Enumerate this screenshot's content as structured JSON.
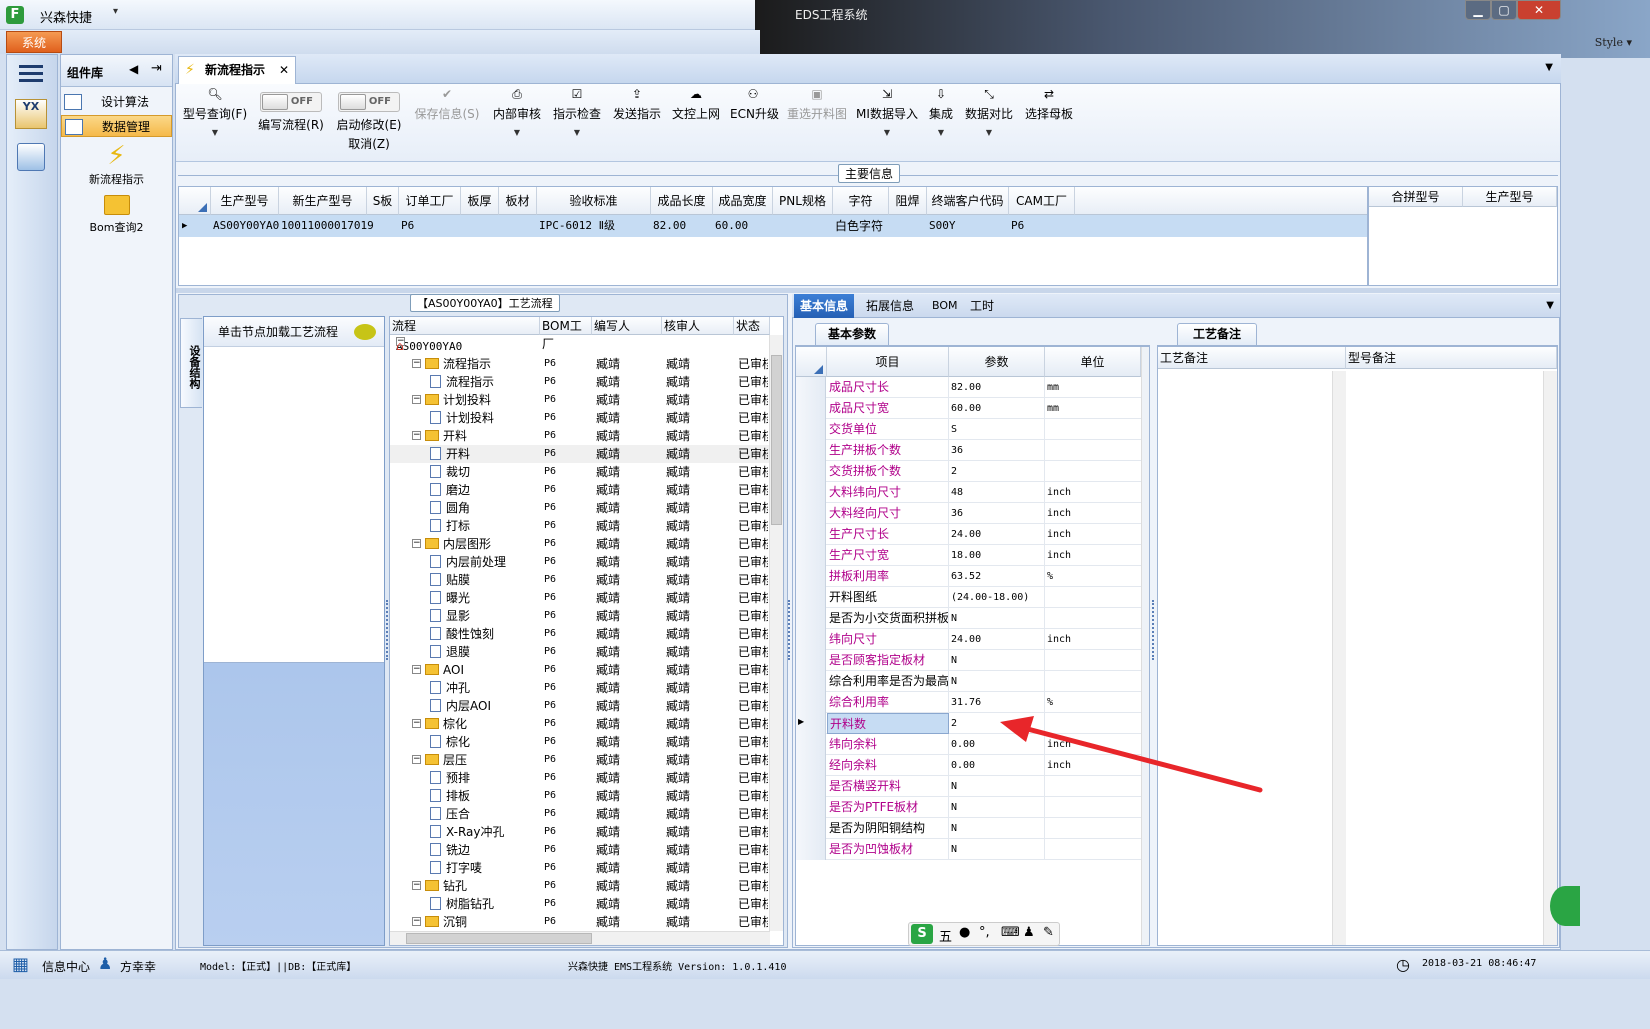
{
  "window": {
    "app_title": "兴森快捷",
    "center_title": "EDS工程系统",
    "style_label": "Style",
    "menu_tab": "系统"
  },
  "left_nav": {
    "header": "组件库",
    "items": [
      {
        "label": "设计算法",
        "selected": false
      },
      {
        "label": "数据管理",
        "selected": true
      }
    ],
    "shortcuts": [
      {
        "label": "新流程指示",
        "icon": "lightning-icon"
      },
      {
        "label": "Bom查询2",
        "icon": "folder-icon"
      }
    ]
  },
  "doc_tab": {
    "label": "新流程指示"
  },
  "ribbon": {
    "buttons": [
      {
        "label": "型号查询(F)",
        "icon": "search-icon",
        "enabled": true,
        "dropdown": true
      },
      {
        "label": "编写流程(R)",
        "toggle": "OFF"
      },
      {
        "label": "启动修改(E)",
        "label2": "取消(Z)",
        "toggle": "OFF"
      },
      {
        "label": "保存信息(S)",
        "icon": "check-icon",
        "enabled": false
      },
      {
        "label": "内部审核",
        "icon": "print-icon",
        "enabled": true,
        "dropdown": true
      },
      {
        "label": "指示检查",
        "icon": "checkbox-icon",
        "enabled": true,
        "dropdown": true
      },
      {
        "label": "发送指示",
        "icon": "upload-icon",
        "enabled": true
      },
      {
        "label": "文控上网",
        "icon": "cloud-upload-icon",
        "enabled": true
      },
      {
        "label": "ECN升级",
        "icon": "binoculars-icon",
        "enabled": true
      },
      {
        "label": "重选开料图",
        "icon": "image-icon",
        "enabled": false
      },
      {
        "label": "MI数据导入",
        "icon": "import-icon",
        "enabled": true,
        "dropdown": true
      },
      {
        "label": "集成",
        "icon": "download-icon",
        "enabled": true,
        "dropdown": true
      },
      {
        "label": "数据对比",
        "icon": "compress-icon",
        "enabled": true,
        "dropdown": true
      },
      {
        "label": "选择母板",
        "icon": "shuffle-icon",
        "enabled": true
      }
    ]
  },
  "main_info": {
    "section_label": "主要信息",
    "columns": [
      "生产型号",
      "新生产型号",
      "S板",
      "订单工厂",
      "板厚",
      "板材",
      "验收标准",
      "成品长度",
      "成品宽度",
      "PNL规格",
      "字符",
      "阻焊",
      "终端客户代码",
      "CAM工厂"
    ],
    "row": [
      "AS00Y00YA0",
      "10011000017019",
      "",
      "P6",
      "",
      "",
      "IPC-6012 Ⅱ级",
      "82.00",
      "60.00",
      "",
      "白色字符",
      "",
      "S00Y",
      "P6"
    ],
    "merge_columns": [
      "合拼型号",
      "生产型号"
    ]
  },
  "flow_panel": {
    "section_label": "【AS00Y00YA0】工艺流程",
    "side_tab": "设备结构",
    "load_hint": "单击节点加载工艺流程",
    "columns": [
      "流程",
      "BOM工厂",
      "编写人",
      "核审人",
      "状态"
    ],
    "root": "AS00Y00YA0",
    "rows": [
      {
        "name": "流程指示",
        "level": 1,
        "folder": true,
        "factory": "P6",
        "writer": "臧靖",
        "reviewer": "臧靖",
        "status": "已审核"
      },
      {
        "name": "流程指示",
        "level": 2,
        "folder": false,
        "factory": "P6",
        "writer": "臧靖",
        "reviewer": "臧靖",
        "status": "已审核"
      },
      {
        "name": "计划投料",
        "level": 1,
        "folder": true,
        "factory": "P6",
        "writer": "臧靖",
        "reviewer": "臧靖",
        "status": "已审核"
      },
      {
        "name": "计划投料",
        "level": 2,
        "folder": false,
        "factory": "P6",
        "writer": "臧靖",
        "reviewer": "臧靖",
        "status": "已审核"
      },
      {
        "name": "开料",
        "level": 1,
        "folder": true,
        "factory": "P6",
        "writer": "臧靖",
        "reviewer": "臧靖",
        "status": "已审核"
      },
      {
        "name": "开料",
        "level": 2,
        "folder": false,
        "factory": "P6",
        "writer": "臧靖",
        "reviewer": "臧靖",
        "status": "已审核",
        "selected": true
      },
      {
        "name": "裁切",
        "level": 2,
        "folder": false,
        "factory": "P6",
        "writer": "臧靖",
        "reviewer": "臧靖",
        "status": "已审核"
      },
      {
        "name": "磨边",
        "level": 2,
        "folder": false,
        "factory": "P6",
        "writer": "臧靖",
        "reviewer": "臧靖",
        "status": "已审核"
      },
      {
        "name": "圆角",
        "level": 2,
        "folder": false,
        "factory": "P6",
        "writer": "臧靖",
        "reviewer": "臧靖",
        "status": "已审核"
      },
      {
        "name": "打标",
        "level": 2,
        "folder": false,
        "factory": "P6",
        "writer": "臧靖",
        "reviewer": "臧靖",
        "status": "已审核"
      },
      {
        "name": "内层图形",
        "level": 1,
        "folder": true,
        "factory": "P6",
        "writer": "臧靖",
        "reviewer": "臧靖",
        "status": "已审核"
      },
      {
        "name": "内层前处理",
        "level": 2,
        "folder": false,
        "factory": "P6",
        "writer": "臧靖",
        "reviewer": "臧靖",
        "status": "已审核"
      },
      {
        "name": "贴膜",
        "level": 2,
        "folder": false,
        "factory": "P6",
        "writer": "臧靖",
        "reviewer": "臧靖",
        "status": "已审核"
      },
      {
        "name": "曝光",
        "level": 2,
        "folder": false,
        "factory": "P6",
        "writer": "臧靖",
        "reviewer": "臧靖",
        "status": "已审核"
      },
      {
        "name": "显影",
        "level": 2,
        "folder": false,
        "factory": "P6",
        "writer": "臧靖",
        "reviewer": "臧靖",
        "status": "已审核"
      },
      {
        "name": "酸性蚀刻",
        "level": 2,
        "folder": false,
        "factory": "P6",
        "writer": "臧靖",
        "reviewer": "臧靖",
        "status": "已审核"
      },
      {
        "name": "退膜",
        "level": 2,
        "folder": false,
        "factory": "P6",
        "writer": "臧靖",
        "reviewer": "臧靖",
        "status": "已审核"
      },
      {
        "name": "AOI",
        "level": 1,
        "folder": true,
        "factory": "P6",
        "writer": "臧靖",
        "reviewer": "臧靖",
        "status": "已审核"
      },
      {
        "name": "冲孔",
        "level": 2,
        "folder": false,
        "factory": "P6",
        "writer": "臧靖",
        "reviewer": "臧靖",
        "status": "已审核"
      },
      {
        "name": "内层AOI",
        "level": 2,
        "folder": false,
        "factory": "P6",
        "writer": "臧靖",
        "reviewer": "臧靖",
        "status": "已审核"
      },
      {
        "name": "棕化",
        "level": 1,
        "folder": true,
        "factory": "P6",
        "writer": "臧靖",
        "reviewer": "臧靖",
        "status": "已审核"
      },
      {
        "name": "棕化",
        "level": 2,
        "folder": false,
        "factory": "P6",
        "writer": "臧靖",
        "reviewer": "臧靖",
        "status": "已审核"
      },
      {
        "name": "层压",
        "level": 1,
        "folder": true,
        "factory": "P6",
        "writer": "臧靖",
        "reviewer": "臧靖",
        "status": "已审核"
      },
      {
        "name": "预排",
        "level": 2,
        "folder": false,
        "factory": "P6",
        "writer": "臧靖",
        "reviewer": "臧靖",
        "status": "已审核"
      },
      {
        "name": "排板",
        "level": 2,
        "folder": false,
        "factory": "P6",
        "writer": "臧靖",
        "reviewer": "臧靖",
        "status": "已审核"
      },
      {
        "name": "压合",
        "level": 2,
        "folder": false,
        "factory": "P6",
        "writer": "臧靖",
        "reviewer": "臧靖",
        "status": "已审核"
      },
      {
        "name": "X-Ray冲孔",
        "level": 2,
        "folder": false,
        "factory": "P6",
        "writer": "臧靖",
        "reviewer": "臧靖",
        "status": "已审核"
      },
      {
        "name": "铣边",
        "level": 2,
        "folder": false,
        "factory": "P6",
        "writer": "臧靖",
        "reviewer": "臧靖",
        "status": "已审核"
      },
      {
        "name": "打字唛",
        "level": 2,
        "folder": false,
        "factory": "P6",
        "writer": "臧靖",
        "reviewer": "臧靖",
        "status": "已审核"
      },
      {
        "name": "钻孔",
        "level": 1,
        "folder": true,
        "factory": "P6",
        "writer": "臧靖",
        "reviewer": "臧靖",
        "status": "已审核"
      },
      {
        "name": "树脂钻孔",
        "level": 2,
        "folder": false,
        "factory": "P6",
        "writer": "臧靖",
        "reviewer": "臧靖",
        "status": "已审核"
      },
      {
        "name": "沉铜",
        "level": 1,
        "folder": true,
        "factory": "P6",
        "writer": "臧靖",
        "reviewer": "臧靖",
        "status": "已审核"
      }
    ]
  },
  "right_panel": {
    "tabs": [
      "基本信息",
      "拓展信息",
      "BOM",
      "工时"
    ],
    "active_tab": "基本信息",
    "params_tab": "基本参数",
    "columns": [
      "项目",
      "参数",
      "单位"
    ],
    "params": [
      {
        "item": "成品尺寸长",
        "value": "82.00",
        "unit": "mm",
        "pink": true
      },
      {
        "item": "成品尺寸宽",
        "value": "60.00",
        "unit": "mm",
        "pink": true
      },
      {
        "item": "交货单位",
        "value": "S",
        "unit": "",
        "pink": true
      },
      {
        "item": "生产拼板个数",
        "value": "36",
        "unit": "",
        "pink": true
      },
      {
        "item": "交货拼板个数",
        "value": "2",
        "unit": "",
        "pink": true
      },
      {
        "item": "大料纬向尺寸",
        "value": "48",
        "unit": "inch",
        "pink": true
      },
      {
        "item": "大料经向尺寸",
        "value": "36",
        "unit": "inch",
        "pink": true
      },
      {
        "item": "生产尺寸长",
        "value": "24.00",
        "unit": "inch",
        "pink": true
      },
      {
        "item": "生产尺寸宽",
        "value": "18.00",
        "unit": "inch",
        "pink": true
      },
      {
        "item": "拼板利用率",
        "value": "63.52",
        "unit": "%",
        "pink": true
      },
      {
        "item": "开料图纸",
        "value": "(24.00-18.00)",
        "unit": "",
        "pink": false
      },
      {
        "item": "是否为小交货面积拼板",
        "value": "N",
        "unit": "",
        "pink": false
      },
      {
        "item": "纬向尺寸",
        "value": "24.00",
        "unit": "inch",
        "pink": true
      },
      {
        "item": "是否顾客指定板材",
        "value": "N",
        "unit": "",
        "pink": true
      },
      {
        "item": "综合利用率是否为最高",
        "value": "N",
        "unit": "",
        "pink": false
      },
      {
        "item": "综合利用率",
        "value": "31.76",
        "unit": "%",
        "pink": true
      },
      {
        "item": "开料数",
        "value": "2",
        "unit": "",
        "pink": true,
        "current": true
      },
      {
        "item": "纬向余料",
        "value": "0.00",
        "unit": "inch",
        "pink": true
      },
      {
        "item": "经向余料",
        "value": "0.00",
        "unit": "inch",
        "pink": true
      },
      {
        "item": "是否横竖开料",
        "value": "N",
        "unit": "",
        "pink": true
      },
      {
        "item": "是否为PTFE板材",
        "value": "N",
        "unit": "",
        "pink": true
      },
      {
        "item": "是否为阴阳铜结构",
        "value": "N",
        "unit": "",
        "pink": false
      },
      {
        "item": "是否为凹蚀板材",
        "value": "N",
        "unit": "",
        "pink": true
      }
    ],
    "remarks_tab": "工艺备注",
    "remarks_columns": [
      "工艺备注",
      "型号备注"
    ]
  },
  "ime": {
    "text": "五"
  },
  "statusbar": {
    "info_center": "信息中心",
    "user": "方幸幸",
    "model_db": "Model:【正式】||DB:【正式库】",
    "center_text": "兴森快捷 EMS工程系统 Version: 1.0.1.410",
    "datetime": "2018-03-21 08:46:47"
  },
  "colors": {
    "accent": "#255fb4",
    "pink_text": "#b0008a",
    "selected_row": "#c6dcf3",
    "annotation_arrow": "#e8262a"
  }
}
